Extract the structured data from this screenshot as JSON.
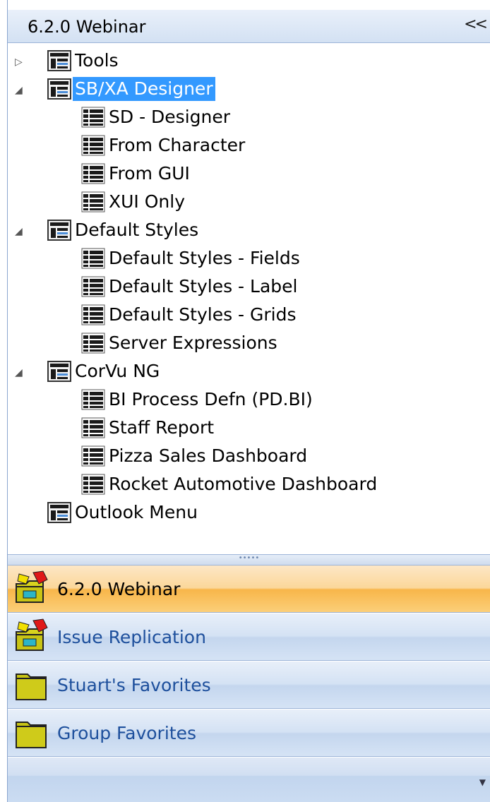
{
  "header": {
    "title": "6.2.0 Webinar",
    "collapse_label": "<<"
  },
  "tree": {
    "nodes": [
      {
        "label": "Tools",
        "expander": "▷"
      },
      {
        "label": "SB/XA Designer",
        "expander": "◢"
      },
      {
        "label": "SD - Designer"
      },
      {
        "label": "From Character"
      },
      {
        "label": "From GUI"
      },
      {
        "label": "XUI Only"
      },
      {
        "label": "Default Styles",
        "expander": "◢"
      },
      {
        "label": "Default Styles - Fields"
      },
      {
        "label": "Default Styles - Label"
      },
      {
        "label": "Default Styles - Grids"
      },
      {
        "label": "Server Expressions"
      },
      {
        "label": "CorVu NG",
        "expander": "◢"
      },
      {
        "label": "BI Process Defn (PD.BI)"
      },
      {
        "label": "Staff Report"
      },
      {
        "label": "Pizza Sales Dashboard"
      },
      {
        "label": "Rocket Automotive Dashboard"
      },
      {
        "label": "Outlook Menu"
      }
    ]
  },
  "splitter": {
    "grip": "•••••"
  },
  "nav_buttons": [
    {
      "label": "6.2.0 Webinar",
      "icon": "folder-star-icon"
    },
    {
      "label": "Issue Replication",
      "icon": "folder-star-icon"
    },
    {
      "label": "Stuart's Favorites",
      "icon": "folder-icon"
    },
    {
      "label": "Group Favorites",
      "icon": "folder-icon"
    }
  ],
  "bottom": {
    "overflow_arrow": "▼"
  },
  "colors": {
    "selection": "#3399ff",
    "active_nav": "#f8b64a",
    "nav_text": "#1d4f9c"
  }
}
